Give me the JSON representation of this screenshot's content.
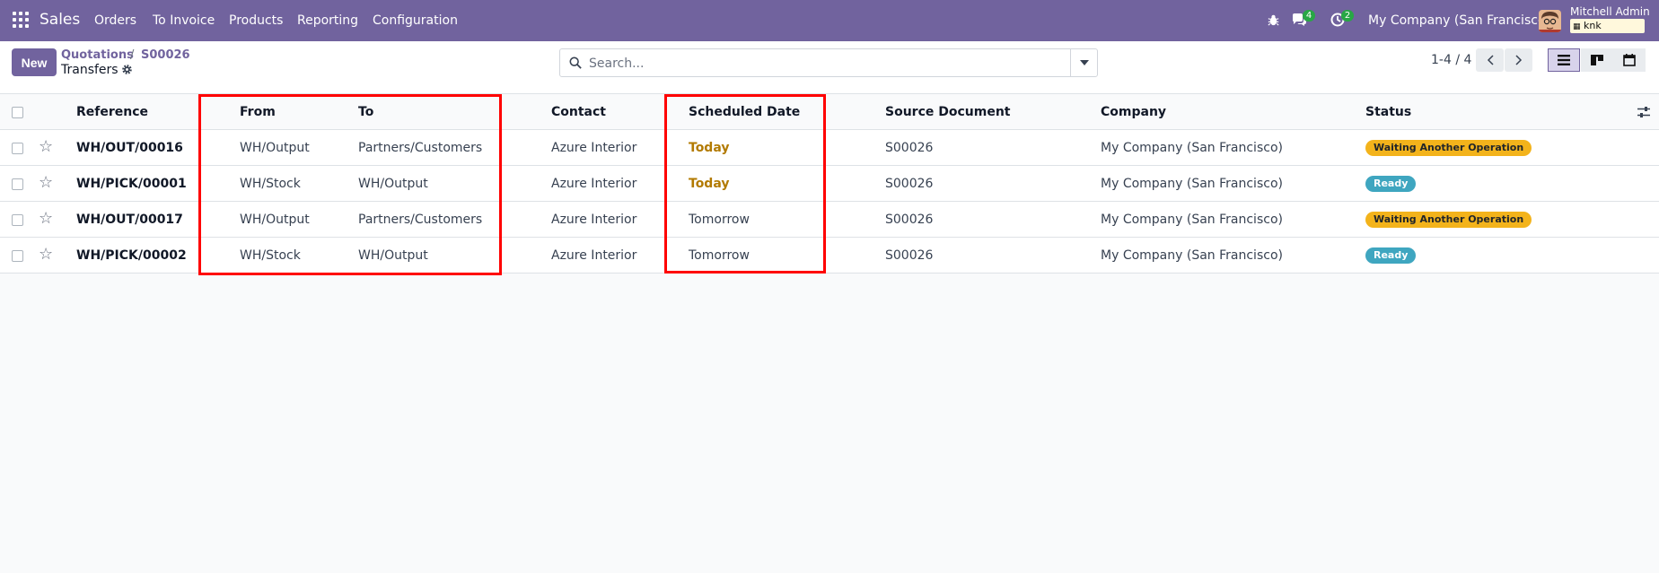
{
  "navbar": {
    "brand": "Sales",
    "menu": [
      "Orders",
      "To Invoice",
      "Products",
      "Reporting",
      "Configuration"
    ],
    "messages_count": "4",
    "activities_count": "2",
    "company": "My Company (San Francisco)",
    "user_name": "Mitchell Admin",
    "database": "knk",
    "bg_color": "#71639e"
  },
  "control_panel": {
    "new_button": "New",
    "breadcrumb": [
      "Quotations",
      "S00026"
    ],
    "breadcrumb_separator": "/",
    "current": "Transfers",
    "search_placeholder": "Search...",
    "pager": "1-4 / 4"
  },
  "table": {
    "columns": [
      "Reference",
      "From",
      "To",
      "Contact",
      "Scheduled Date",
      "Source Document",
      "Company",
      "Status"
    ],
    "rows": [
      {
        "reference": "WH/OUT/00016",
        "from": "WH/Output",
        "to": "Partners/Customers",
        "contact": "Azure Interior",
        "scheduled_date": "Today",
        "source": "S00026",
        "company": "My Company (San Francisco)",
        "status": "Waiting Another Operation"
      },
      {
        "reference": "WH/PICK/00001",
        "from": "WH/Stock",
        "to": "WH/Output",
        "contact": "Azure Interior",
        "scheduled_date": "Today",
        "source": "S00026",
        "company": "My Company (San Francisco)",
        "status": "Ready"
      },
      {
        "reference": "WH/OUT/00017",
        "from": "WH/Output",
        "to": "Partners/Customers",
        "contact": "Azure Interior",
        "scheduled_date": "Tomorrow",
        "source": "S00026",
        "company": "My Company (San Francisco)",
        "status": "Waiting Another Operation"
      },
      {
        "reference": "WH/PICK/00002",
        "from": "WH/Stock",
        "to": "WH/Output",
        "contact": "Azure Interior",
        "scheduled_date": "Tomorrow",
        "source": "S00026",
        "company": "My Company (San Francisco)",
        "status": "Ready"
      }
    ]
  },
  "colors": {
    "waiting": "#f3b31b",
    "ready": "#3fa6c0",
    "today": "#b27a00",
    "annotation": "#ff0000"
  }
}
